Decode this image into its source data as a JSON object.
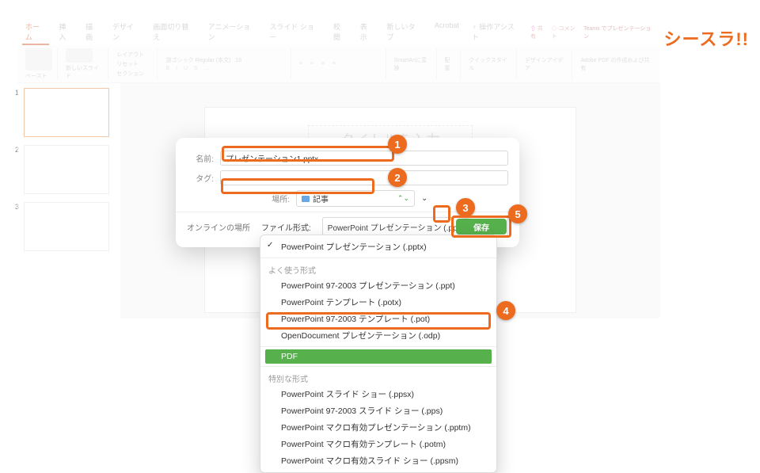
{
  "brand": "シースラ!!",
  "tabs": [
    "ホーム",
    "挿入",
    "描画",
    "デザイン",
    "画面切り替え",
    "アニメーション",
    "スライド ショー",
    "校閲",
    "表示",
    "新しいタブ",
    "Acrobat",
    "操作アシスト"
  ],
  "top_right": {
    "share": "共有",
    "comment": "コメント",
    "teams": "Teams でプレゼンテーション"
  },
  "ribbon": {
    "paste": "ペースト",
    "newslide": "新しいスライド",
    "layout": "レイアウト",
    "reset": "リセット",
    "section": "セクション",
    "font": "游ゴシック Regular (本文)",
    "size": "18",
    "smartart": "SmartArtに変換",
    "arrange": "配置",
    "quickstyle": "クイックスタイル",
    "designideas": "デザインアイデア",
    "adobepdf": "Adobe PDF の作成および共有"
  },
  "thumbs": [
    "1",
    "2",
    "3"
  ],
  "slide_title": "タイトルを入力",
  "dialog": {
    "name_lbl": "名前:",
    "name_val": "プレゼンテーション1.pptx",
    "tag_lbl": "タグ:",
    "loc_lbl": "場所:",
    "loc_val": "記事",
    "online": "オンラインの場所",
    "fmt_lbl": "ファイル形式:",
    "fmt_val": "PowerPoint プレゼンテーション (.pptx)",
    "save": "保存"
  },
  "dropdown": {
    "top": "PowerPoint プレゼンテーション (.pptx)",
    "h1": "よく使う形式",
    "g1": [
      "PowerPoint 97-2003 プレゼンテーション (.ppt)",
      "PowerPoint テンプレート (.potx)",
      "PowerPoint 97-2003 テンプレート (.pot)",
      "OpenDocument プレゼンテーション (.odp)"
    ],
    "pdf": "PDF",
    "h2": "特別な形式",
    "g2": [
      "PowerPoint スライド ショー (.ppsx)",
      "PowerPoint 97-2003 スライド ショー (.pps)",
      "PowerPoint マクロ有効プレゼンテーション (.pptm)",
      "PowerPoint マクロ有効テンプレート (.potm)",
      "PowerPoint マクロ有効スライド ショー (.ppsm)"
    ]
  },
  "badges": [
    "1",
    "2",
    "3",
    "4",
    "5"
  ]
}
